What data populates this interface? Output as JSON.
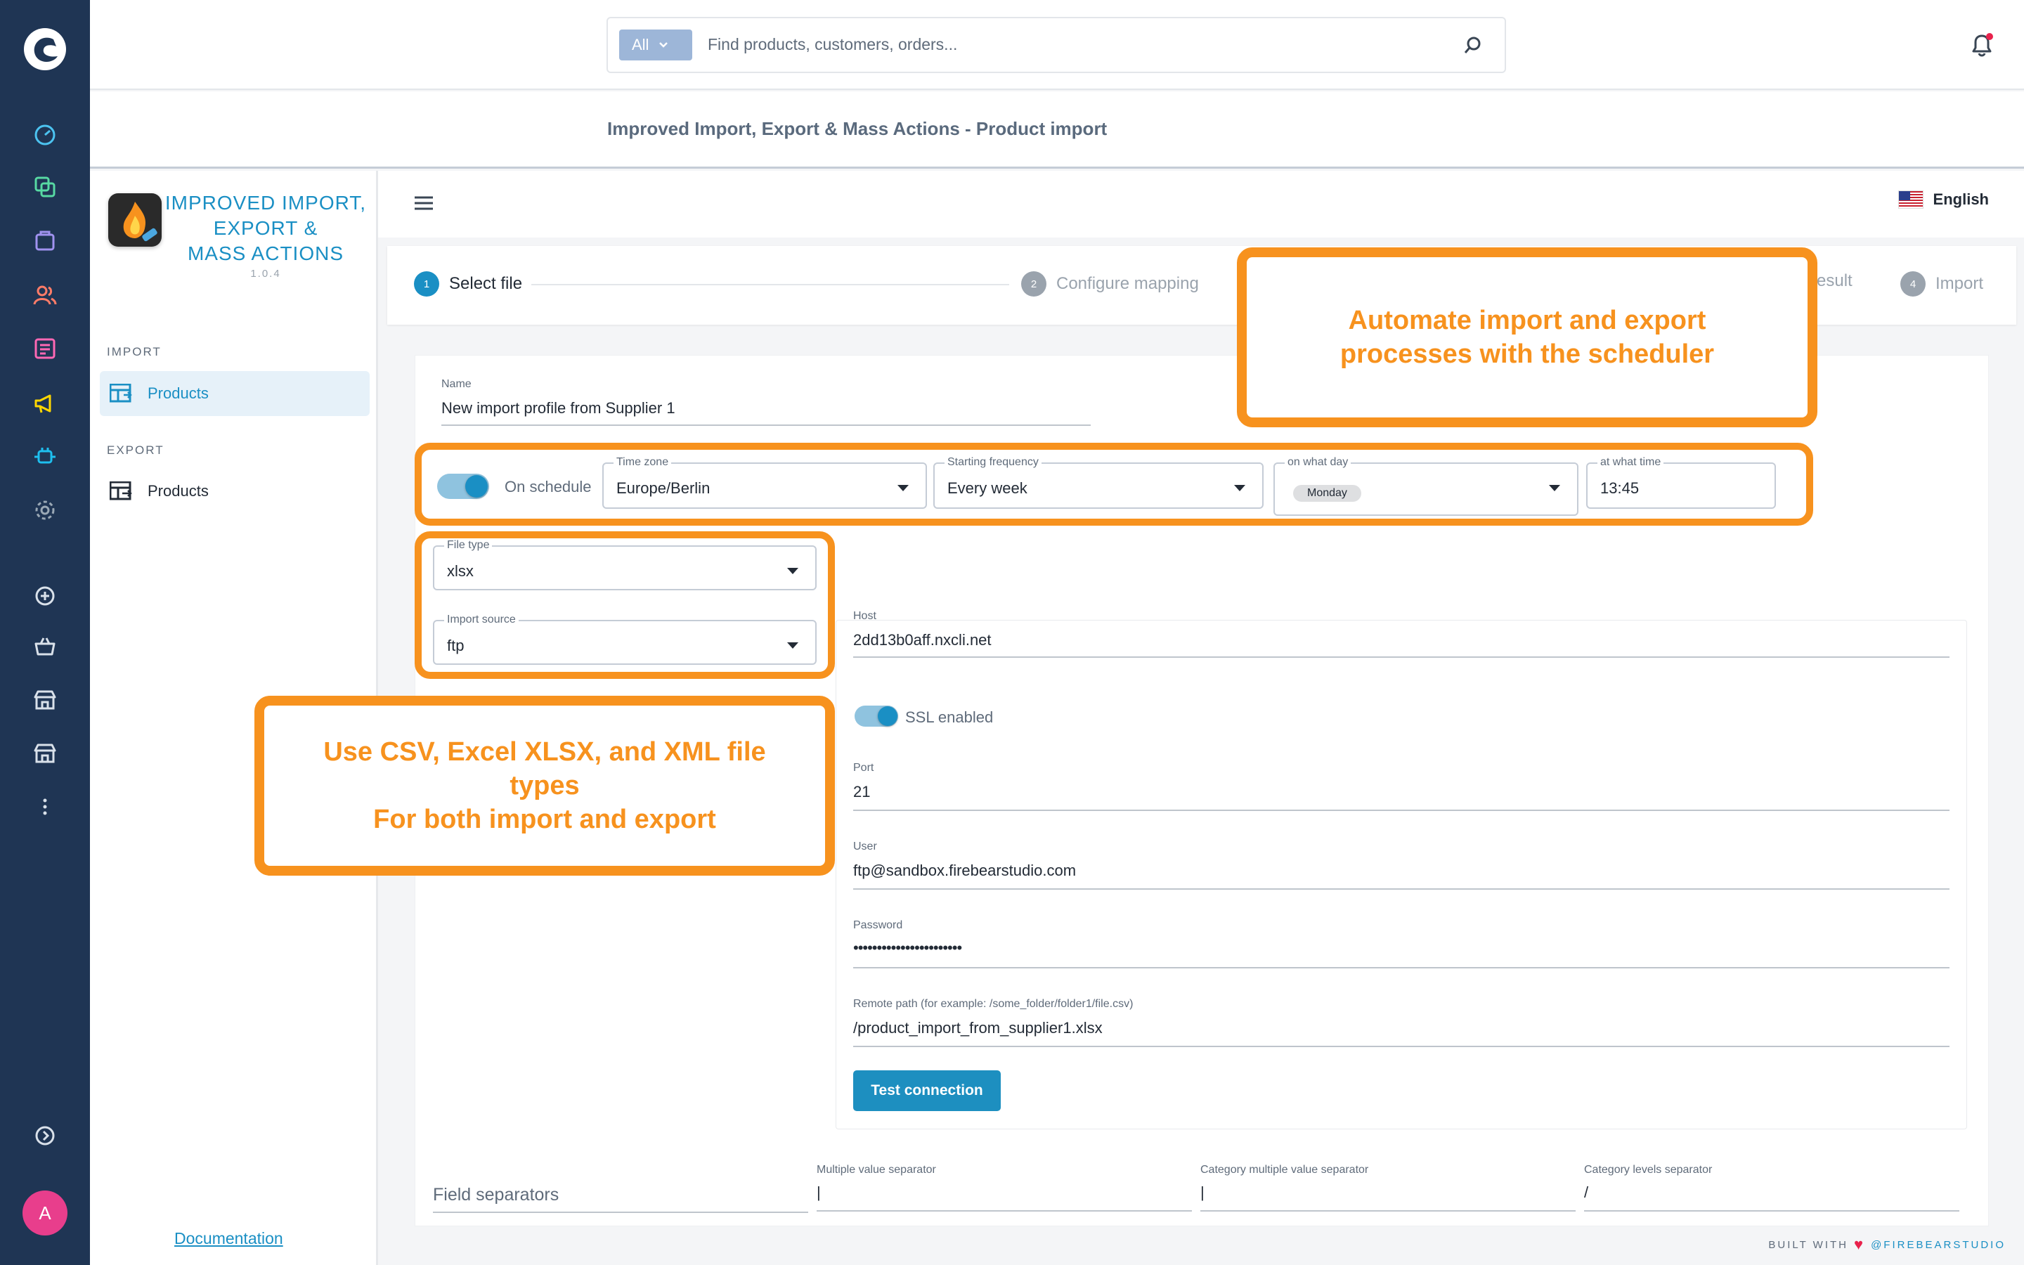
{
  "search": {
    "scope": "All",
    "placeholder": "Find products, customers, orders..."
  },
  "breadcrumb": "Improved Import, Export & Mass Actions - Product import",
  "plugin": {
    "title_lines": [
      "IMPROVED IMPORT,",
      "EXPORT &",
      "MASS ACTIONS"
    ],
    "version": "1.0.4",
    "import_section": "IMPORT",
    "import_item": "Products",
    "export_section": "EXPORT",
    "export_item": "Products",
    "documentation": "Documentation"
  },
  "header": {
    "language": "English"
  },
  "steps": [
    {
      "num": "1",
      "label": "Select file"
    },
    {
      "num": "2",
      "label": "Configure mapping"
    },
    {
      "num": "",
      "label": "esult"
    },
    {
      "num": "4",
      "label": "Import"
    }
  ],
  "form": {
    "name_label": "Name",
    "name_value": "New import profile from Supplier 1",
    "schedule_label": "On schedule",
    "timezone_label": "Time zone",
    "timezone_value": "Europe/Berlin",
    "frequency_label": "Starting frequency",
    "frequency_value": "Every week",
    "day_label": "on what day",
    "day_value": "Monday",
    "time_label": "at what time",
    "time_value": "13:45",
    "filetype_label": "File type",
    "filetype_value": "xlsx",
    "source_label": "Import source",
    "source_value": "ftp",
    "host_label": "Host",
    "host_value": "2dd13b0aff.nxcli.net",
    "ssl_label": "SSL enabled",
    "port_label": "Port",
    "port_value": "21",
    "user_label": "User",
    "user_value": "ftp@sandbox.firebearstudio.com",
    "password_label": "Password",
    "password_value": "•••••••••••••••••••••••",
    "remote_label": "Remote path (for example: /some_folder/folder1/file.csv)",
    "remote_value": "/product_import_from_supplier1.xlsx",
    "test_button": "Test connection",
    "field_separators": "Field separators",
    "multi_sep_label": "Multiple value separator",
    "multi_sep_value": "|",
    "cat_multi_sep_label": "Category multiple value separator",
    "cat_multi_sep_value": "|",
    "cat_levels_label": "Category levels separator",
    "cat_levels_value": "/"
  },
  "callouts": {
    "scheduler_lines": [
      "Automate import and export",
      "processes with the scheduler"
    ],
    "filetypes_lines": [
      "Use CSV, Excel XLSX, and XML file",
      "types",
      "For both import and export"
    ]
  },
  "footer": {
    "built_with": "BUILT WITH",
    "brand": "@FIREBEARSTUDIO"
  },
  "user": {
    "initial": "A"
  },
  "colors": {
    "accent": "#1a8fc4",
    "highlight": "#f7921e",
    "nav": "#1f3554"
  }
}
